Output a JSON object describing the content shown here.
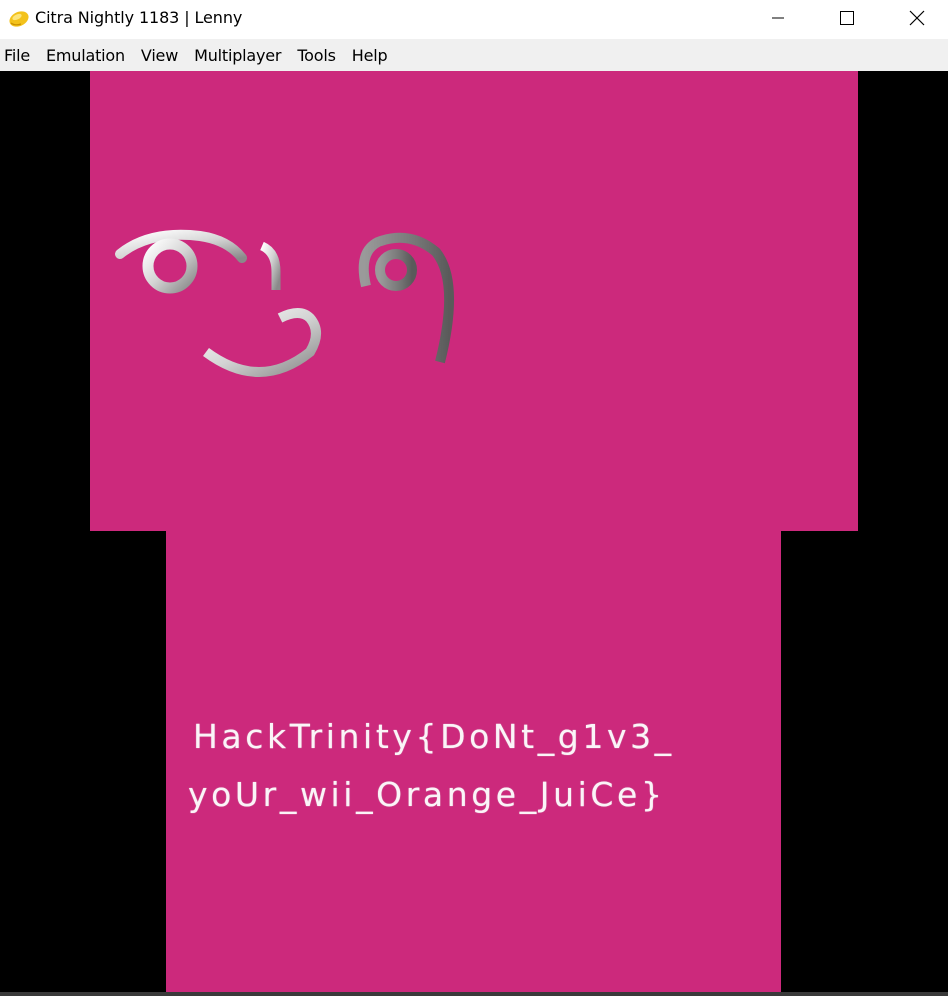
{
  "window": {
    "title": "Citra Nightly 1183 | Lenny",
    "app_icon": "citra-lemon-icon",
    "controls": {
      "minimize": "minimize-icon",
      "maximize": "maximize-icon",
      "close": "close-icon"
    }
  },
  "menubar": {
    "items": [
      "File",
      "Emulation",
      "View",
      "Multiplayer",
      "Tools",
      "Help"
    ]
  },
  "top_screen": {
    "background": "#cc297c",
    "face": "( ͡° ͜ʖ ͡°)"
  },
  "bottom_screen": {
    "background": "#cc297c",
    "flag_line_1": "HackTrinity{DoNt_g1v3_",
    "flag_line_2": "yoUr_wii_Orange_JuiCe}"
  }
}
